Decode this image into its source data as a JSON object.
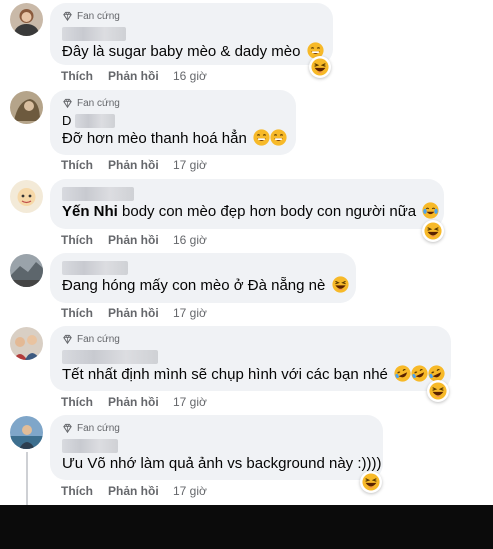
{
  "comments": [
    {
      "badge": "Fan cứng",
      "name_prefix": "",
      "text": "Đây là sugar baby mèo & dady mèo",
      "like_label": "Thích",
      "reply_label": "Phản hồi",
      "time": "16 giờ"
    },
    {
      "badge": "Fan cứng",
      "name_prefix": "D",
      "text": "Đỡ hơn mèo thanh hoá hẳn",
      "like_label": "Thích",
      "reply_label": "Phản hồi",
      "time": "17 giờ"
    },
    {
      "badge": "",
      "name_prefix": "",
      "mention": "Yến Nhi",
      "text": " body con mèo đẹp hơn body con người nữa",
      "like_label": "Thích",
      "reply_label": "Phản hồi",
      "time": "16 giờ"
    },
    {
      "badge": "",
      "name_prefix": "",
      "text": "Đang hóng mấy con mèo ở Đà nẵng nè",
      "like_label": "Thích",
      "reply_label": "Phản hồi",
      "time": "17 giờ"
    },
    {
      "badge": "Fan cứng",
      "name_prefix": "",
      "text": "Tết nhất định mình sẽ chụp hình với các bạn nhé",
      "like_label": "Thích",
      "reply_label": "Phản hồi",
      "time": "17 giờ"
    },
    {
      "badge": "Fan cứng",
      "name_prefix": "",
      "text": "Ưu Võ nhớ làm quả ảnh vs background này :))))",
      "like_label": "Thích",
      "reply_label": "Phản hồi",
      "time": "17 giờ"
    }
  ],
  "icons": {
    "badge_icon": "diamond-icon",
    "reaction_icon": "laugh-emoji-icon"
  },
  "colors": {
    "bubble": "#f0f2f5",
    "secondary_text": "#65676b",
    "reaction_yellow": "#f7b125"
  }
}
